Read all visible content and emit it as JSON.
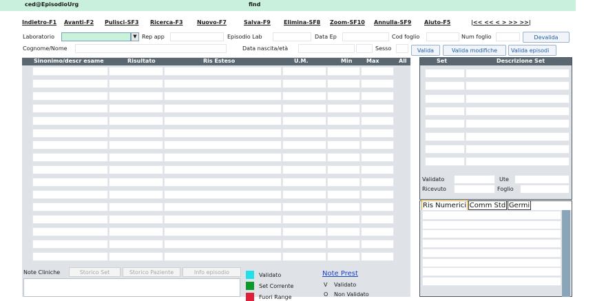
{
  "topbar": {
    "left": "ced@EpisodioUrg",
    "right": "find"
  },
  "fkeys": [
    "Indietro-F1",
    "Avanti-F2",
    "Pulisci-SF3",
    "Ricerca-F3",
    "Nuovo-F7",
    "Salva-F9",
    "Elimina-SF8",
    "Zoom-SF10",
    "Annulla-SF9",
    "Aiuto-F5",
    "|<< << <  >  >> >>|"
  ],
  "form": {
    "laboratorio": "Laboratorio",
    "rep_app": "Rep app",
    "episodio_lab": "Episodio Lab",
    "data_ep": "Data Ep",
    "cod_foglio": "Cod foglio",
    "num_foglio": "Num foglio",
    "cognome_nome": "Cognome/Nome",
    "data_nascita": "Data nascita/età",
    "sesso": "Sesso"
  },
  "buttons": {
    "devalida": "Devalida",
    "valida": "Valida",
    "valida_modifiche": "Valida modifiche",
    "valida_episodio": "Valida episodi"
  },
  "grid": {
    "headers": [
      "Sinonimo/descr esame",
      "Risultato",
      "Ris Esteso",
      "U.M.",
      "Min",
      "Max",
      "All"
    ]
  },
  "set_panel": {
    "headers": [
      "Set",
      "Descrizione Set"
    ],
    "validato": "Validato",
    "ute": "Ute",
    "ricevuto": "Ricevuto",
    "foglio": "Foglio"
  },
  "tabs": [
    "Ris Numerici",
    "Comm Std",
    "Germi"
  ],
  "bottom": {
    "note_cliniche": "Note Cliniche",
    "storico_set": "Storico Set",
    "storico_paziente": "Storico Paziente",
    "info_episodio": "Info episodio",
    "note_prest": "Note Prest"
  },
  "legend": [
    {
      "label": "Validato",
      "color": "#22e0e8"
    },
    {
      "label": "Set Corrente",
      "color": "#0a9a2a"
    },
    {
      "label": "Fuori Range",
      "color": "#e0203a"
    }
  ],
  "prest_legend": [
    {
      "code": "V",
      "label": "Validato"
    },
    {
      "code": "O",
      "label": "Non Validato"
    }
  ]
}
